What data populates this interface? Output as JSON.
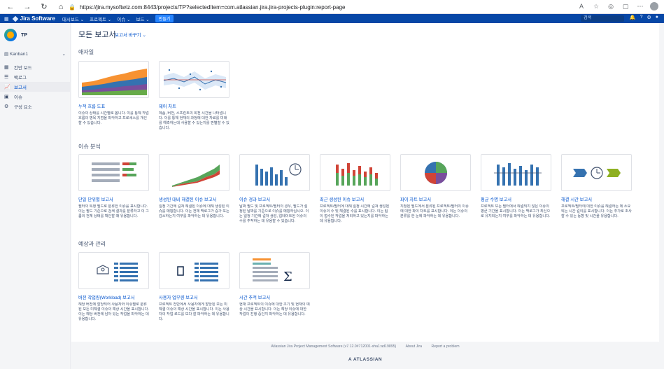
{
  "browser": {
    "url": "https://jira.mysoftwiz.com:8443/projects/TP?selectedItem=com.atlassian.jira.jira-projects-plugin:report-page"
  },
  "nav": {
    "brand": "Jira Software",
    "menu": [
      "대시보드 ⌄",
      "프로젝트 ⌄",
      "이슈 ⌄",
      "보드 ⌄"
    ],
    "create_label": "만들기",
    "search_placeholder": "검색"
  },
  "sidebar": {
    "project_key": "TP",
    "board": "Kanban1",
    "items": [
      {
        "label": "칸반 보드",
        "icon": "board-icon"
      },
      {
        "label": "백로그",
        "icon": "backlog-icon"
      },
      {
        "label": "보고서",
        "icon": "report-icon",
        "active": true
      },
      {
        "label": "이슈",
        "icon": "issues-icon"
      },
      {
        "label": "구성 요소",
        "icon": "components-icon"
      }
    ]
  },
  "main": {
    "title": "모든 보고서",
    "switch_label": "보고서 바꾸기 ⌄",
    "sections": {
      "agile": "애자일",
      "issue_analysis": "이슈 분석",
      "forecast": "예상과 관리"
    },
    "cards": [
      {
        "title": "누적 흐름 도표",
        "desc": "이슈의 상태를 시간별로 봅니다. 이를 통해 작업 흐름의 병목 지점을 파악하고 프로세스를 개선할 수 있습니다."
      },
      {
        "title": "제어 차트",
        "desc": "제품, 버전, 스프린트의 회전 시간을 나타냅니다. 이를 통해 현재의 과정에 대한 자료를 미래를 예측하는데 사용할 수 있는지를 판별할 수 있습니다."
      },
      {
        "title": "단일 단위별 보고서",
        "desc": "필터의 특정 필드로 분류한 이슈를 표시합니다. 이는 필드 기준으로 검색 결과를 분류하고 이 그룹의 전체 상태를 확인할 때 유용합니다."
      },
      {
        "title": "생성된 대비 해결된 이슈 보고서",
        "desc": "일정 기간에 걸쳐 해결된 이슈에 대해 생성된 이슈를 매핑합니다. 이는 전체 백로그가 증가 또는 감소하는지 여부를 파악하는 데 유용합니다."
      },
      {
        "title": "이슈 경과 보고서",
        "desc": "날짜 필드 및 프로젝트/필터의 경우, 필드가 설정된 날짜를 기준으로 이슈를 매핑하십시오. 이는 일정 기간에 걸쳐 생성, 업데이트된 이슈의 수를 추적하는 데 유용할 수 있습니다."
      },
      {
        "title": "최근 생성된 이슈 보고서",
        "desc": "프로젝트/필터에 대해 일정 시간에 걸쳐 생성된 이슈의 수 및 해결된 수를 표시합니다. 이는 팀이 접수된 작업을 처리하고 있는지를 파악하는 데 유용합니다."
      },
      {
        "title": "파이 차트 보고서",
        "desc": "지정된 필드에서 분류된 프로젝트/필터의 이슈에 대한 파이 차트를 표시합니다. 이는 이슈의 분류를 한 눈에 파악하는 데 유용합니다."
      },
      {
        "title": "평균 수명 보고서",
        "desc": "프로젝트 또는 필터에서 해결되지 않은 이슈의 평균 기간을 표시합니다. 이는 백로그가 최신으로 유지되는지 여부를 파악하는 데 유용합니다."
      },
      {
        "title": "해결 시간 보고서",
        "desc": "프로젝트/필터에 대한 이슈를 해결하는 데 소요되는 시간 길이를 표시합니다. 이는 추가로 조사할 수 있는 동향 및 시간을 유용합니다."
      },
      {
        "title": "버전 작업량(Workload) 보고서",
        "desc": "해당 버전에 할당되어 사용자와 이슈별로 분류된 모든 미해결 이슈의 예상 시간을 표시합니다. 이는 해당 버전에 남아 있는 작업을 파악하는 데 유용합니다."
      },
      {
        "title": "사용자 업무량 보고서",
        "desc": "프로젝트 전반에서 사용자에게 할당된 모든 미해결 이슈의 예상 시간을 표시합니다. 이는 사용자의 작업 로드를 보다 잘 파악하는 데 유용합니다."
      },
      {
        "title": "시간 추적 보고서",
        "desc": "현재 프로젝트의 이슈에 대한 초기 및 현재의 예상 시간을 표시합니다. 이는 해당 이슈에 대한 작업이 진행 중인지 파악하는 데 유용합니다."
      }
    ]
  },
  "footer": {
    "version": "Atlassian Jira Project Management Software (v7.12.0#712001-sha1:ad19895)",
    "about": "About Jira",
    "report": "Report a problem",
    "logo": "A ATLASSIAN"
  },
  "colors": {
    "nav_bg": "#0747a6",
    "link": "#0052cc",
    "accent_green": "#57a55a",
    "accent_red": "#d04437",
    "accent_orange": "#f79232",
    "accent_blue": "#3572b0"
  }
}
